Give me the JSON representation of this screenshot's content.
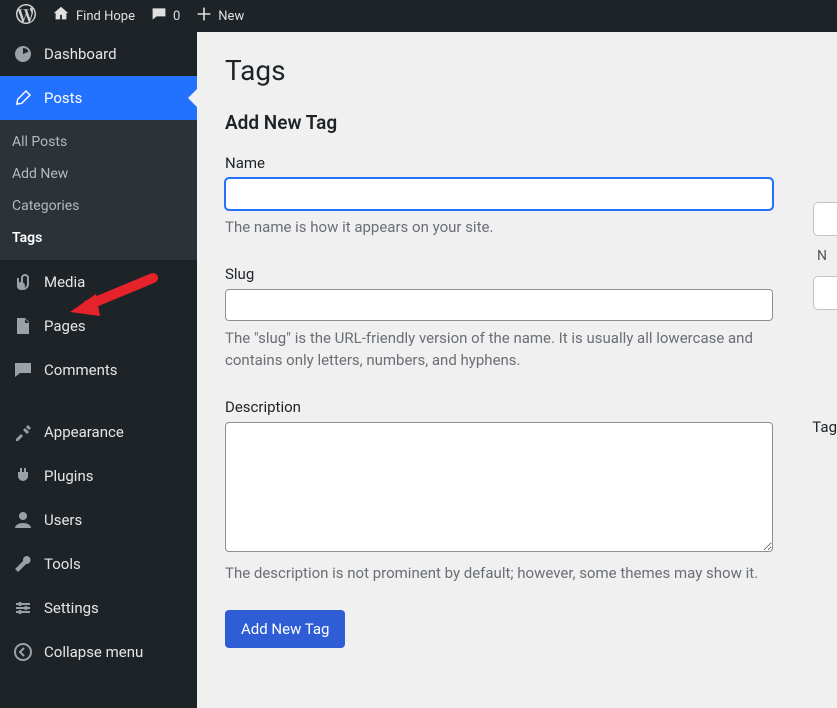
{
  "topbar": {
    "site_name": "Find Hope",
    "comments_count": "0",
    "new_label": "New"
  },
  "sidebar": {
    "dashboard": "Dashboard",
    "posts": "Posts",
    "posts_sub": {
      "all": "All Posts",
      "add": "Add New",
      "categories": "Categories",
      "tags": "Tags"
    },
    "media": "Media",
    "pages": "Pages",
    "comments": "Comments",
    "appearance": "Appearance",
    "plugins": "Plugins",
    "users": "Users",
    "tools": "Tools",
    "settings": "Settings",
    "collapse": "Collapse menu"
  },
  "page": {
    "title": "Tags",
    "subtitle": "Add New Tag",
    "name_label": "Name",
    "name_value": "",
    "name_help": "The name is how it appears on your site.",
    "slug_label": "Slug",
    "slug_value": "",
    "slug_help": "The \"slug\" is the URL-friendly version of the name. It is usually all lowercase and contains only letters, numbers, and hyphens.",
    "desc_label": "Description",
    "desc_value": "",
    "desc_help": "The description is not prominent by default; however, some themes may show it.",
    "submit": "Add New Tag"
  },
  "right": {
    "peek_label": "N",
    "footer": "Tag"
  }
}
